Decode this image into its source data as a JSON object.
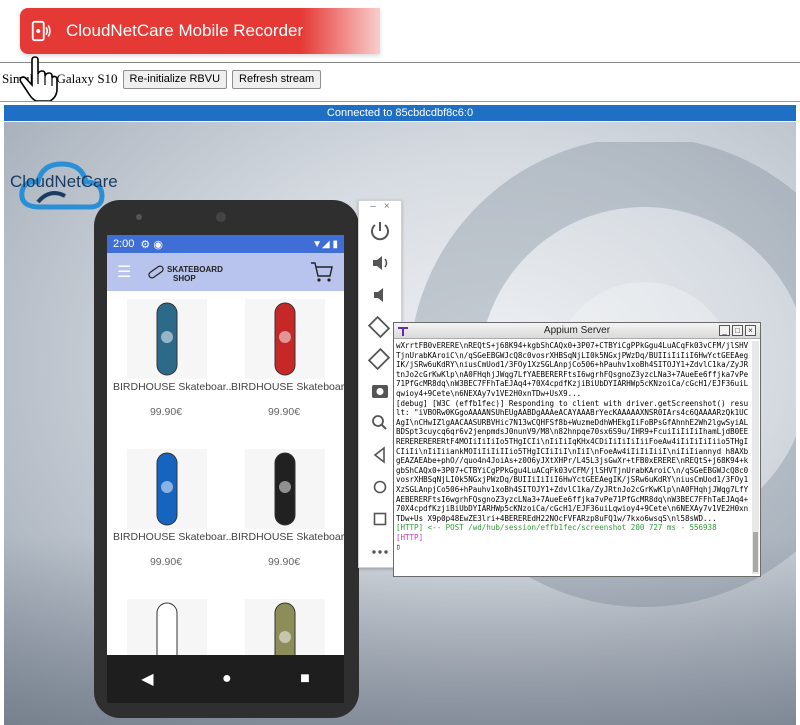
{
  "banner": {
    "title": "CloudNetCare Mobile Recorder"
  },
  "toolbar": {
    "device_label": "Simulator Galaxy S10",
    "reinit_label": "Re-initialize RBVU",
    "refresh_label": "Refresh stream"
  },
  "stream": {
    "connection_status": "Connected to 85cbdcdbf8c6:0"
  },
  "logo": {
    "text": "CloudNetCare"
  },
  "phone": {
    "status_time": "2:00",
    "brand_line1": "SKATEBOARD",
    "brand_line2": "SHOP",
    "products": [
      {
        "title": "BIRDHOUSE Skateboar...",
        "price": "99.90€",
        "color": "#2d6a8a"
      },
      {
        "title": "BIRDHOUSE Skateboar...",
        "price": "99.90€",
        "color": "#c62828"
      },
      {
        "title": "BIRDHOUSE Skateboar...",
        "price": "99.90€",
        "color": "#1565c0"
      },
      {
        "title": "BIRDHOUSE Skateboar...",
        "price": "99.90€",
        "color": "#212121"
      },
      {
        "title": "",
        "price": "",
        "color": "#ffffff"
      },
      {
        "title": "",
        "price": "",
        "color": "#8d8d5a"
      }
    ]
  },
  "appium": {
    "title": "Appium Server",
    "lines": [
      "wXrrtFB0vERERE\\nREQtS+j68K94+kgbShCAQx0+3P07+CTBYiCgPPkGgu4LuACqFk03vCFM/jlSHVTjnUrabKAroiC\\n/qSGeEBGWJcQ8c0vosrXHBSqNjLI0k5NGxjPWzDq/BUIIiIiIiI6HwYctGEEAegIK/jSRw6uKdRY\\niusCmUod1/3FOy1XzSGLAnpjCo506+hPauhv1xoBh4SITOJY1+ZdvlC1ka/ZyJRtnJo2cGrKwKlp\\nA0FHqhjJWqg7LfYAEBERERFtsI6wgrhFQsgnoZ3yzcLNa3+7AueEe6ffjka7vPe71PfGcMR8dq\\nW3BEC7FFhTaEJAq4+70X4cpdfKzjiBiUbDYIARHWp5cKNzoiCa/cGcH1/EJF36uiLqwioy4+9Cete\\n6NEXAy7v1VE2H0xnTDw+UsX9...",
      "[debug] [W3C (effb1fec)] Responding to client with driver.getScreenshot() result: \"iVBORw0KGgoAAAANSUhEUgAABDgAAAeACAYAAABrYecKAAAAAXNSR0IArs4c6QAAAARzQk1UCAgI\\nCHwIZlgAACAASURBVHic7N13wCQHFSf8b+WuzmeDdhWHEkgIiFoBPsGfAhnhE2Wh2lgwSyiALBDSpt3cuycq6qr6v2jenpmdsJ0nunV9/M8\\n82hnpqe70sx6S9u/IHR9+FcuiIiIiIiIhamLjdB0EERERERERERERtF4MOIiIiIiIo5THgICIi\\nIiIiIqKHx4CDiIiIiIiIiiFoeAw4iIiIiIiIiio5THgICIiIi\\nIiIiiankMOIiIiIiIIio5THgICIiIiI\\nIiI\\nFoeAw4iIiIiIiiI\\niIiIiannyd h8AXbgEAZAEAbe+phO//quo4n4JoiAs+z0O6yJXtXHPr/L45L3jsGwXr+tFB0xERERE\\nREQtS+j68K94+kgbShCAQx0+3P07+CTBYiCgPPkGgu4LuACqFk03vCFM/jlSHVTjnUrabKAroiC\\n/qSGeEBGWJcQ8c0vosrXHBSqNjLI0k5NGxjPWzDq/BUIIiIiIiI6HwYctGEEAegIK/jSRw6uKdRY\\niusCmUod1/3FOy1XzSGLAnpjCo506+hPauhv1xoBh4SITOJY1+ZdvlC1ka/ZyJRtnJo2cGrKwKlp\\nA0FHqhjJWqg7LfYAEBERERFtsI6wgrhFQsgnoZ3yzcLNa3+7AueEe6ffjka7vPe71PfGcMR8dq\\nW3BEC7FFhTaEJAq4+70X4cpdfKzjiBiUbDYIARHWp5cKNzoiCa/cGcH1/EJF36uiLqwioy4+9Cete\\n6NEXAy7v1VE2H0xnTDw+Us X9p0p48EwZE3lri+4BEREREdH22NOcFVFARzp8uFQ1w/7kxo6wsqS\\nl58sWD...",
      "[HTTP] <-- POST /wd/hub/session/effb1fec/screenshot 200 727 ms - 556938",
      "[HTTP]"
    ]
  }
}
